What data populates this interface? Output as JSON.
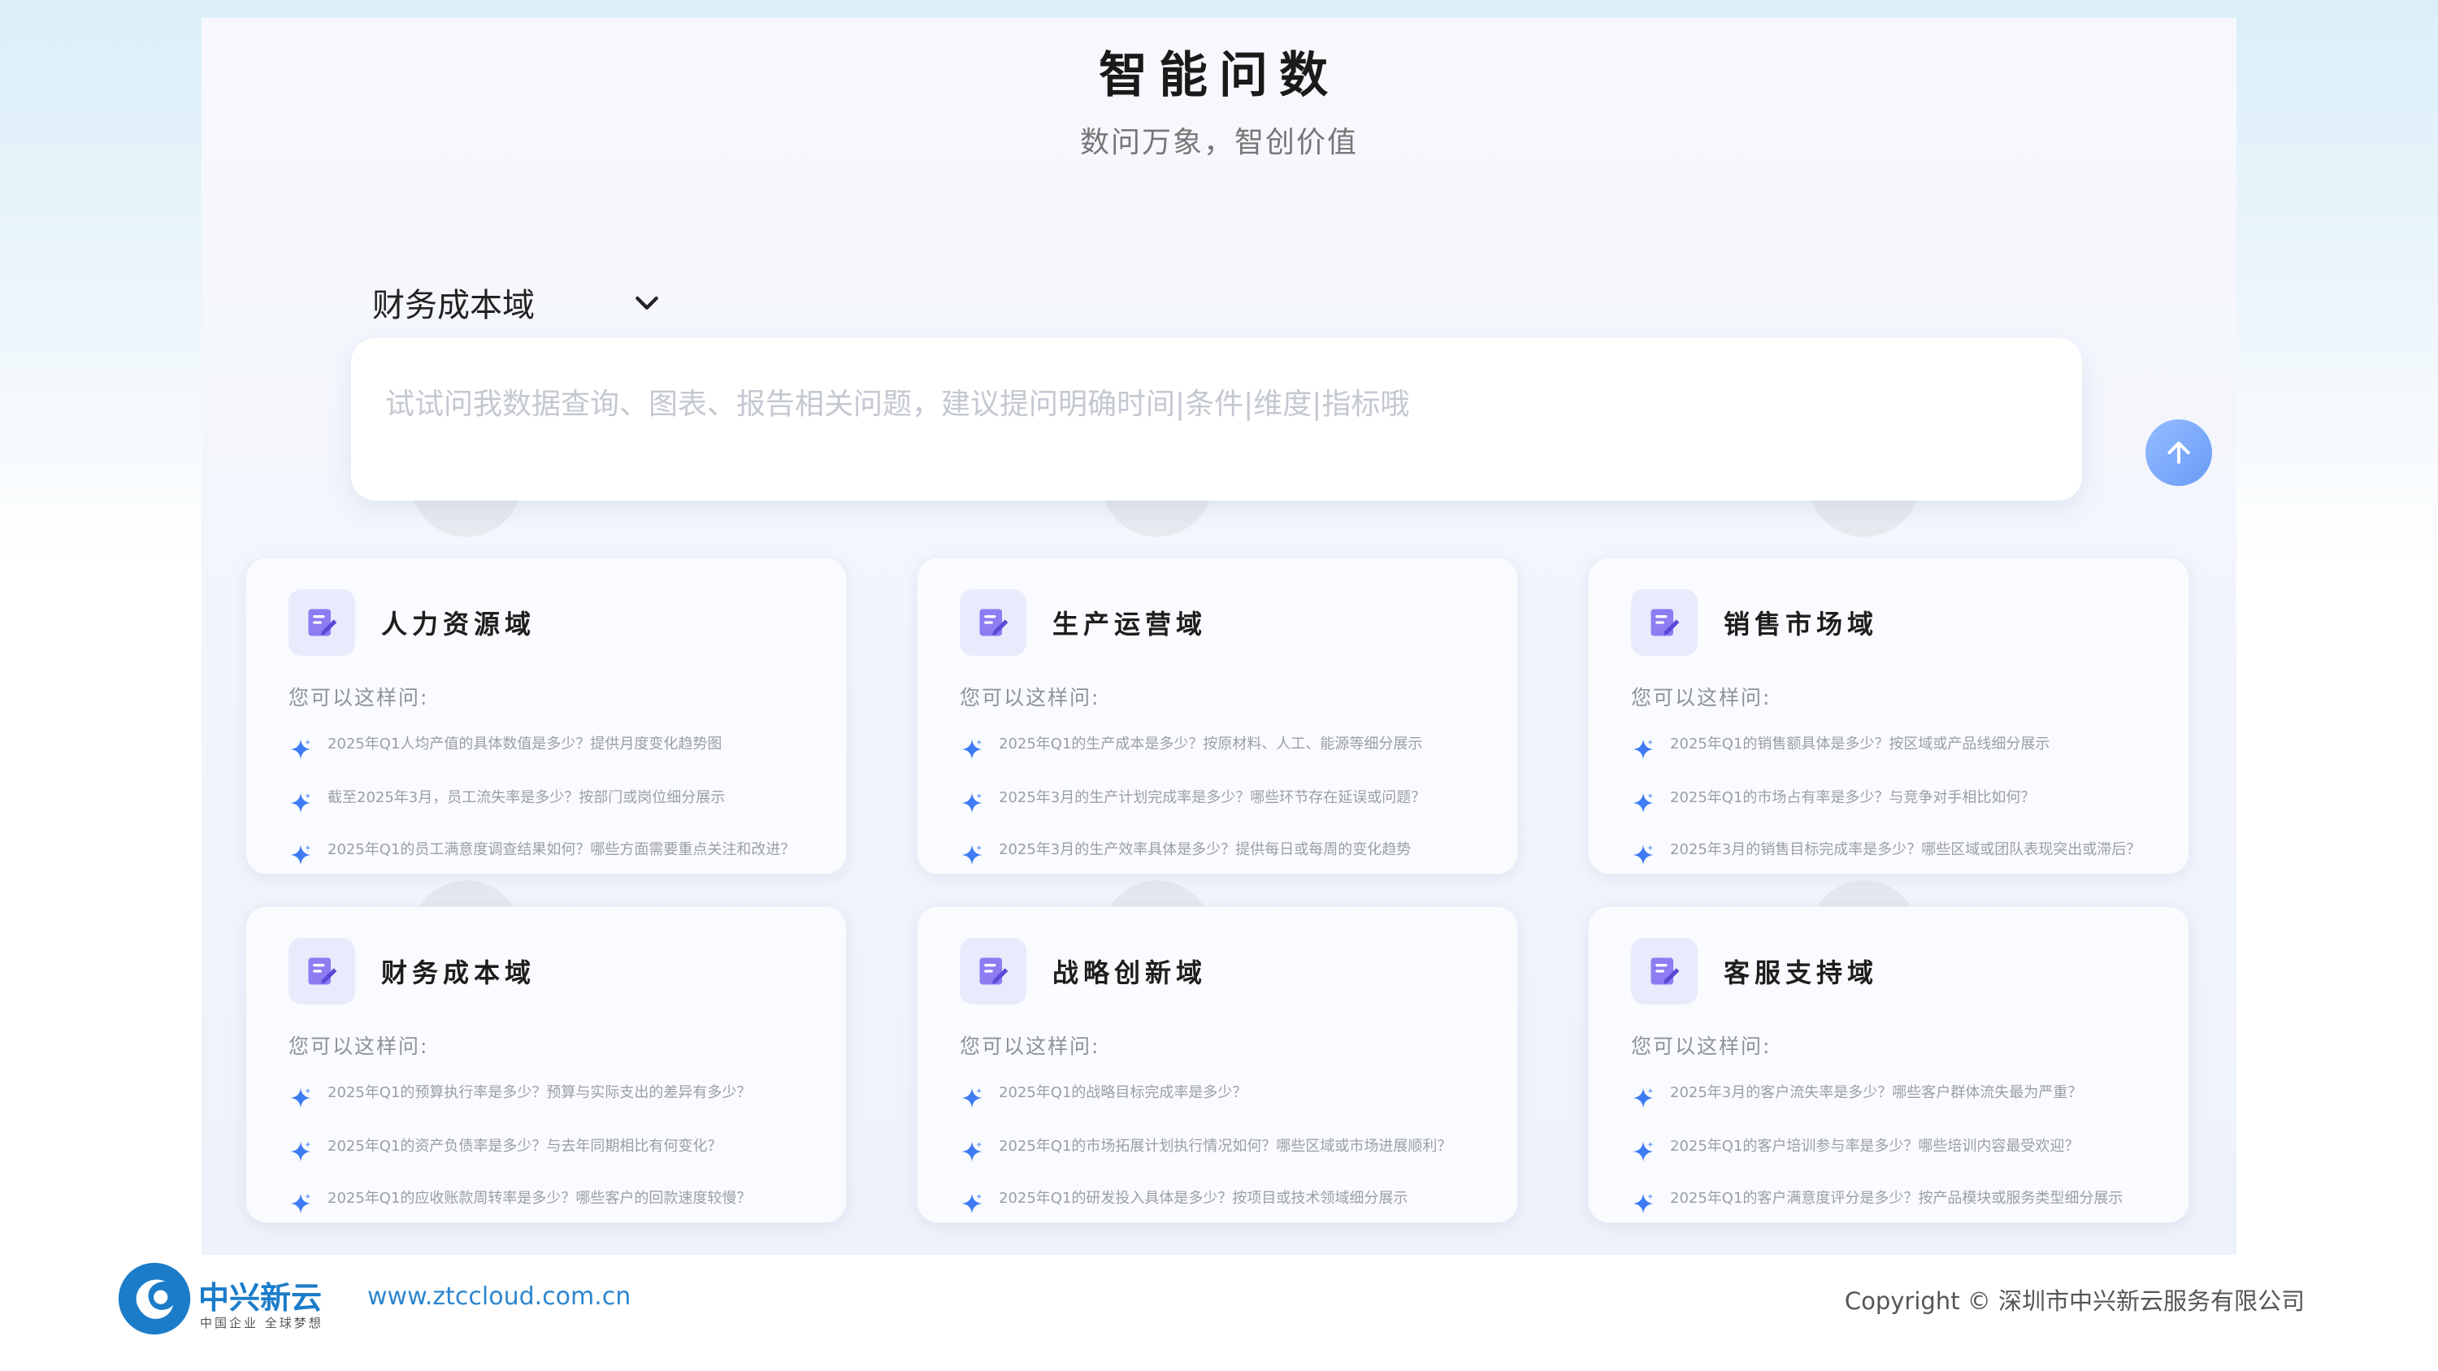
{
  "header": {
    "title": "智能问数",
    "subtitle": "数问万象，智创价值"
  },
  "domain_select": {
    "selected": "财务成本域",
    "icon": "chevron-down-icon"
  },
  "question_box": {
    "placeholder": "试试问我数据查询、图表、报告相关问题，建议提问明确时间|条件|维度|指标哦",
    "send_icon": "arrow-up-icon"
  },
  "prompt_label": "您可以这样问:",
  "cards": [
    {
      "title": "人力资源域",
      "icon": "edit-icon",
      "prompt": "您可以这样问:",
      "questions": [
        "2025年Q1人均产值的具体数值是多少？提供月度变化趋势图",
        "截至2025年3月，员工流失率是多少？按部门或岗位细分展示",
        "2025年Q1的员工满意度调查结果如何？哪些方面需要重点关注和改进？"
      ]
    },
    {
      "title": "生产运营域",
      "icon": "edit-icon",
      "prompt": "您可以这样问:",
      "questions": [
        "2025年Q1的生产成本是多少？按原材料、人工、能源等细分展示",
        "2025年3月的生产计划完成率是多少？哪些环节存在延误或问题？",
        "2025年3月的生产效率具体是多少？提供每日或每周的变化趋势"
      ]
    },
    {
      "title": "销售市场域",
      "icon": "edit-icon",
      "prompt": "您可以这样问:",
      "questions": [
        "2025年Q1的销售额具体是多少？按区域或产品线细分展示",
        "2025年Q1的市场占有率是多少？与竞争对手相比如何？",
        "2025年3月的销售目标完成率是多少？哪些区域或团队表现突出或滞后？"
      ]
    },
    {
      "title": "财务成本域",
      "icon": "edit-icon",
      "prompt": "您可以这样问:",
      "questions": [
        "2025年Q1的预算执行率是多少？预算与实际支出的差异有多少？",
        "2025年Q1的资产负债率是多少？与去年同期相比有何变化？",
        "2025年Q1的应收账款周转率是多少？哪些客户的回款速度较慢？"
      ]
    },
    {
      "title": "战略创新域",
      "icon": "edit-icon",
      "prompt": "您可以这样问:",
      "questions": [
        "2025年Q1的战略目标完成率是多少？",
        "2025年Q1的市场拓展计划执行情况如何？哪些区域或市场进展顺利？",
        "2025年Q1的研发投入具体是多少？按项目或技术领域细分展示"
      ]
    },
    {
      "title": "客服支持域",
      "icon": "edit-icon",
      "prompt": "您可以这样问:",
      "questions": [
        "2025年3月的客户流失率是多少？哪些客户群体流失最为严重？",
        "2025年Q1的客户培训参与率是多少？哪些培训内容最受欢迎？",
        "2025年Q1的客户满意度评分是多少？按产品模块或服务类型细分展示"
      ]
    }
  ],
  "footer": {
    "brand": "中兴新云",
    "slogan": "中国企业 全球梦想",
    "url": "www.ztccloud.com.cn",
    "copyright": "Copyright © 深圳市中兴新云服务有限公司"
  },
  "colors": {
    "accent": "#6a9cf7",
    "brand": "#1b7cc9",
    "icon_purple": "#7f6cf0",
    "star_blue": "#3f7cf3"
  }
}
